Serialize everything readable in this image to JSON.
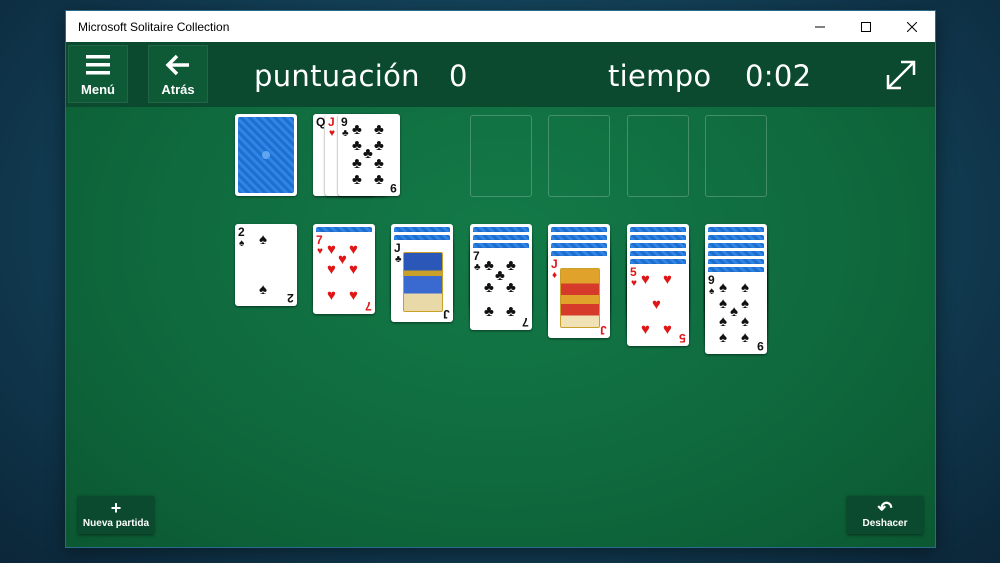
{
  "window": {
    "title": "Microsoft Solitaire Collection"
  },
  "toolbar": {
    "menu_label": "Menú",
    "back_label": "Atrás",
    "score_label": "puntuación",
    "score_value": "0",
    "time_label": "tiempo",
    "time_value": "0:02"
  },
  "waste": {
    "cards": [
      {
        "rank": "Q",
        "suit": "♣",
        "color": "black"
      },
      {
        "rank": "J",
        "suit": "♥",
        "color": "red"
      },
      {
        "rank": "9",
        "suit": "♣",
        "color": "black"
      }
    ]
  },
  "tableau": [
    {
      "hidden": 0,
      "rank": "2",
      "suit": "♠",
      "color": "black"
    },
    {
      "hidden": 1,
      "rank": "7",
      "suit": "♥",
      "color": "red"
    },
    {
      "hidden": 2,
      "rank": "J",
      "suit": "♣",
      "color": "black"
    },
    {
      "hidden": 3,
      "rank": "7",
      "suit": "♣",
      "color": "black"
    },
    {
      "hidden": 4,
      "rank": "J",
      "suit": "♦",
      "color": "red"
    },
    {
      "hidden": 5,
      "rank": "5",
      "suit": "♥",
      "color": "red"
    },
    {
      "hidden": 6,
      "rank": "9",
      "suit": "♠",
      "color": "black"
    }
  ],
  "bottom": {
    "new_game_label": "Nueva partida",
    "undo_label": "Deshacer"
  },
  "colors": {
    "felt": "#0f6a3e",
    "topbar": "#0b4a2e",
    "red_suit": "#e01616"
  }
}
